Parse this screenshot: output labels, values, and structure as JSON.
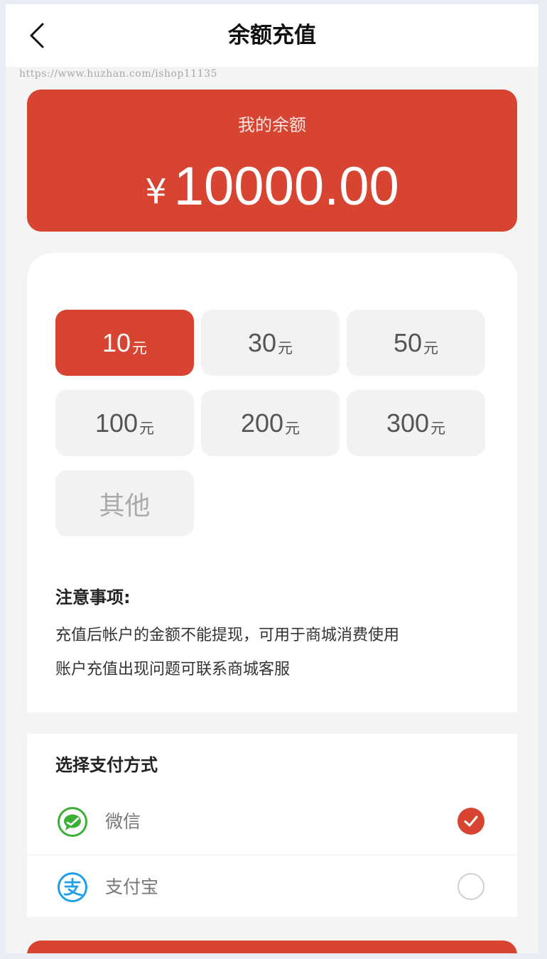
{
  "header": {
    "title": "余额充值",
    "back_icon": "chevron-left-icon"
  },
  "watermark": "https://www.huzhan.com/ishop11135",
  "balance": {
    "label": "我的余额",
    "currency": "¥",
    "amount": "10000.00"
  },
  "amounts": {
    "options": [
      {
        "value": "10",
        "unit": "元"
      },
      {
        "value": "30",
        "unit": "元"
      },
      {
        "value": "50",
        "unit": "元"
      },
      {
        "value": "100",
        "unit": "元"
      },
      {
        "value": "200",
        "unit": "元"
      },
      {
        "value": "300",
        "unit": "元"
      }
    ],
    "other_label": "其他",
    "selected": "10"
  },
  "notice": {
    "title": "注意事项:",
    "lines": [
      "充值后帐户的金额不能提现，可用于商城消费使用",
      "账户充值出现问题可联系商城客服"
    ]
  },
  "payment": {
    "title": "选择支付方式",
    "methods": [
      {
        "label": "微信",
        "icon": "wechat-icon",
        "checked": true
      },
      {
        "label": "支付宝",
        "icon": "alipay-icon",
        "checked": false
      }
    ]
  },
  "colors": {
    "accent": "#d74532",
    "wechat": "#3cb034",
    "alipay": "#1e9fe8"
  }
}
